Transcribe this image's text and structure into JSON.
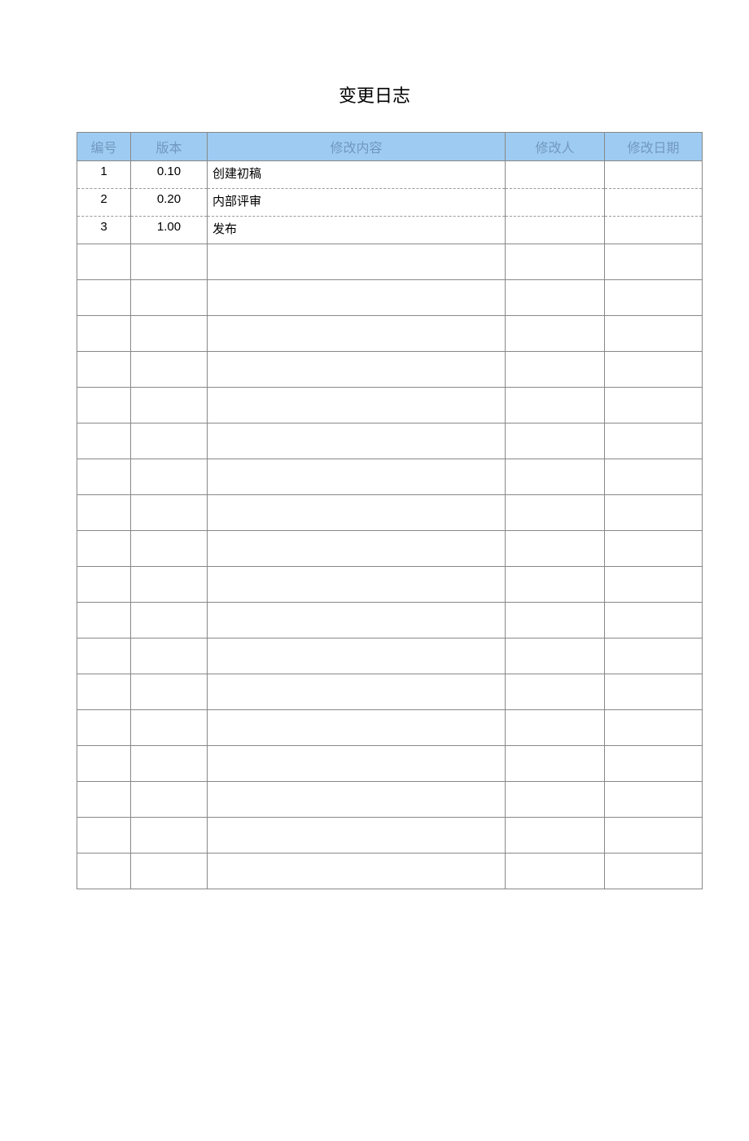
{
  "title": "变更日志",
  "headers": {
    "num": "编号",
    "version": "版本",
    "content": "修改内容",
    "author": "修改人",
    "date": "修改日期"
  },
  "rows": [
    {
      "num": "1",
      "version": "0.10",
      "content": "创建初稿",
      "author": "",
      "date": ""
    },
    {
      "num": "2",
      "version": "0.20",
      "content": "内部评审",
      "author": "",
      "date": ""
    },
    {
      "num": "3",
      "version": "1.00",
      "content": "发布",
      "author": "",
      "date": ""
    }
  ],
  "empty_row_count": 18
}
